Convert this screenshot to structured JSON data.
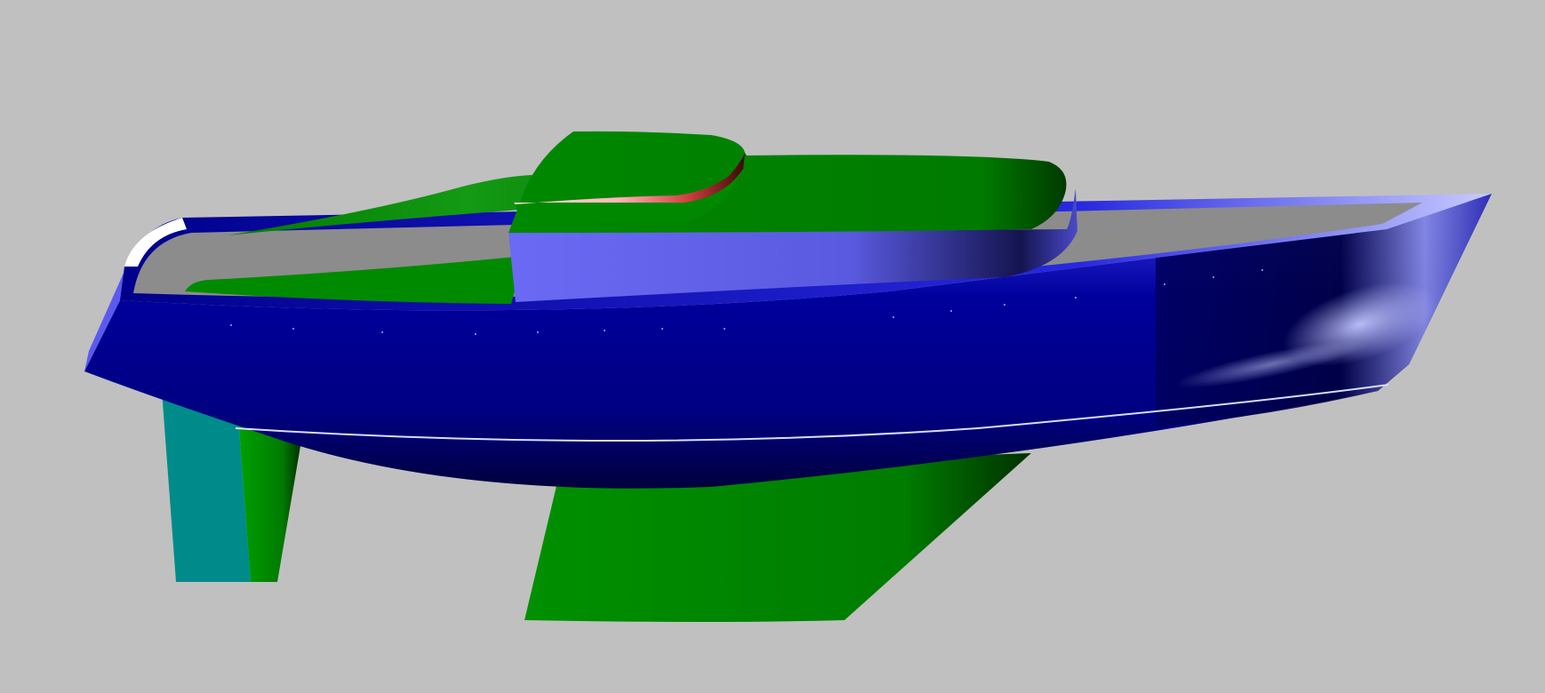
{
  "viewport": {
    "background_color": "#c0c0c0",
    "subject": "yacht-hull-3d-render",
    "colors": {
      "hull_dark": "#00003c",
      "hull_mid": "#00009c",
      "hull_light": "#3c3cf0",
      "hull_highlight": "#b8bcf4",
      "deck_grey": "#8c8c8c",
      "cabin_green": "#008800",
      "cabin_green_light": "#1a9a1a",
      "cabin_side_blue": "#6a6af4",
      "keel_green": "#008a00",
      "rudder_teal": "#008b8b",
      "accent_pink": "#ffc8c8",
      "accent_red": "#6a1010"
    }
  }
}
